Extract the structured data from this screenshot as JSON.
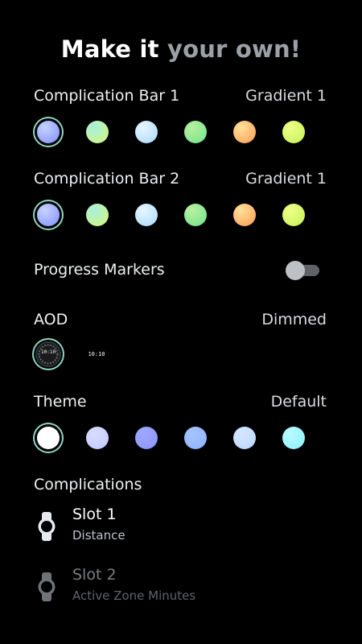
{
  "header": {
    "title_main": "Make it",
    "title_accent": "your own!"
  },
  "complication_bar_1": {
    "label": "Complication Bar 1",
    "value": "Gradient 1",
    "swatches": [
      {
        "name": "gradient-blue",
        "colors": [
          "#c7d2ff",
          "#7f8fff"
        ],
        "selected": true
      },
      {
        "name": "gradient-mint-lime",
        "colors": [
          "#a8f0e0",
          "#d8f774"
        ],
        "selected": false
      },
      {
        "name": "gradient-ice-blue",
        "colors": [
          "#e7f6ff",
          "#a8d8ff"
        ],
        "selected": false
      },
      {
        "name": "gradient-green",
        "colors": [
          "#b9f0a0",
          "#6ee38a"
        ],
        "selected": false
      },
      {
        "name": "gradient-orange",
        "colors": [
          "#ffe19a",
          "#ff9a52"
        ],
        "selected": false
      },
      {
        "name": "gradient-lime",
        "colors": [
          "#f0ff8a",
          "#c3f255"
        ],
        "selected": false
      }
    ]
  },
  "complication_bar_2": {
    "label": "Complication Bar 2",
    "value": "Gradient 1",
    "swatches": [
      {
        "name": "gradient-blue",
        "colors": [
          "#c7d2ff",
          "#7f8fff"
        ],
        "selected": true
      },
      {
        "name": "gradient-mint-lime",
        "colors": [
          "#a8f0e0",
          "#d8f774"
        ],
        "selected": false
      },
      {
        "name": "gradient-ice-blue",
        "colors": [
          "#e7f6ff",
          "#a8d8ff"
        ],
        "selected": false
      },
      {
        "name": "gradient-green",
        "colors": [
          "#b9f0a0",
          "#6ee38a"
        ],
        "selected": false
      },
      {
        "name": "gradient-orange",
        "colors": [
          "#ffe19a",
          "#ff9a52"
        ],
        "selected": false
      },
      {
        "name": "gradient-lime",
        "colors": [
          "#f0ff8a",
          "#c3f255"
        ],
        "selected": false
      }
    ]
  },
  "progress_markers": {
    "label": "Progress Markers",
    "enabled": false
  },
  "aod": {
    "label": "AOD",
    "value": "Dimmed",
    "options": [
      {
        "name": "dimmed",
        "time": "10:10",
        "selected": true
      },
      {
        "name": "minimal",
        "time": "10:10",
        "selected": false
      }
    ]
  },
  "theme": {
    "label": "Theme",
    "value": "Default",
    "swatches": [
      {
        "name": "white",
        "colors": [
          "#ffffff",
          "#ffffff"
        ],
        "selected": true
      },
      {
        "name": "periwinkle-light",
        "colors": [
          "#d7dcff",
          "#c2c9ff"
        ],
        "selected": false
      },
      {
        "name": "periwinkle",
        "colors": [
          "#9fa8ff",
          "#8a94f6"
        ],
        "selected": false
      },
      {
        "name": "cornflower",
        "colors": [
          "#a5c3ff",
          "#8db3ff"
        ],
        "selected": false
      },
      {
        "name": "sky-light",
        "colors": [
          "#d4e6ff",
          "#bcd8ff"
        ],
        "selected": false
      },
      {
        "name": "aqua",
        "colors": [
          "#b8fbff",
          "#8cf0ff"
        ],
        "selected": false
      }
    ]
  },
  "complications": {
    "label": "Complications",
    "slots": [
      {
        "title": "Slot 1",
        "subtitle": "Distance",
        "icon": "watch-icon",
        "enabled": true
      },
      {
        "title": "Slot 2",
        "subtitle": "Active Zone Minutes",
        "icon": "watch-icon",
        "enabled": false
      }
    ]
  },
  "colors": {
    "background": "#000000",
    "selection_ring": "#8fd6c2",
    "accent_text": "#9aa0a6"
  }
}
